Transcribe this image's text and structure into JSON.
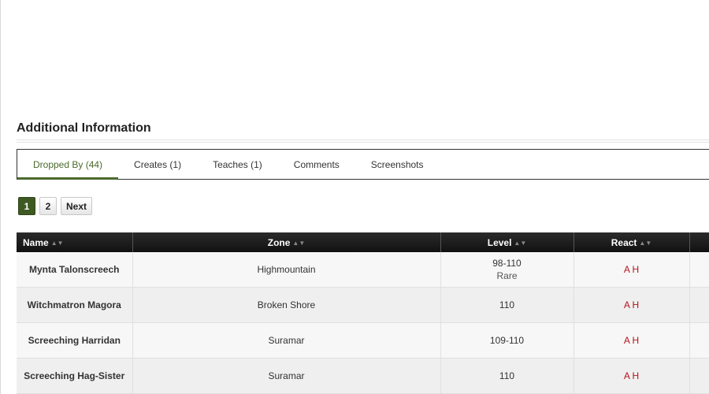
{
  "section": {
    "title": "Additional Information"
  },
  "tabs": [
    {
      "label": "Dropped By (44)",
      "active": true
    },
    {
      "label": "Creates (1)",
      "active": false
    },
    {
      "label": "Teaches (1)",
      "active": false
    },
    {
      "label": "Comments",
      "active": false
    },
    {
      "label": "Screenshots",
      "active": false
    }
  ],
  "pager": {
    "page1": "1",
    "page2": "2",
    "next": "Next",
    "current": 1
  },
  "table": {
    "headers": {
      "name": "Name",
      "zone": "Zone",
      "level": "Level",
      "react": "React"
    },
    "rows": [
      {
        "name": "Mynta Talonscreech",
        "zone": "Highmountain",
        "level": "98-110",
        "level_sub": "Rare",
        "react_a": "A",
        "react_h": "H"
      },
      {
        "name": "Witchmatron Magora",
        "zone": "Broken Shore",
        "level": "110",
        "level_sub": "",
        "react_a": "A",
        "react_h": "H"
      },
      {
        "name": "Screeching Harridan",
        "zone": "Suramar",
        "level": "109-110",
        "level_sub": "",
        "react_a": "A",
        "react_h": "H"
      },
      {
        "name": "Screeching Hag-Sister",
        "zone": "Suramar",
        "level": "110",
        "level_sub": "",
        "react_a": "A",
        "react_h": "H"
      }
    ]
  },
  "colors": {
    "accent": "#4b6a2c",
    "react": "#b8121b",
    "header_bg": "#1a1a1a"
  },
  "icons": {
    "sort": "sort-arrows-icon"
  }
}
